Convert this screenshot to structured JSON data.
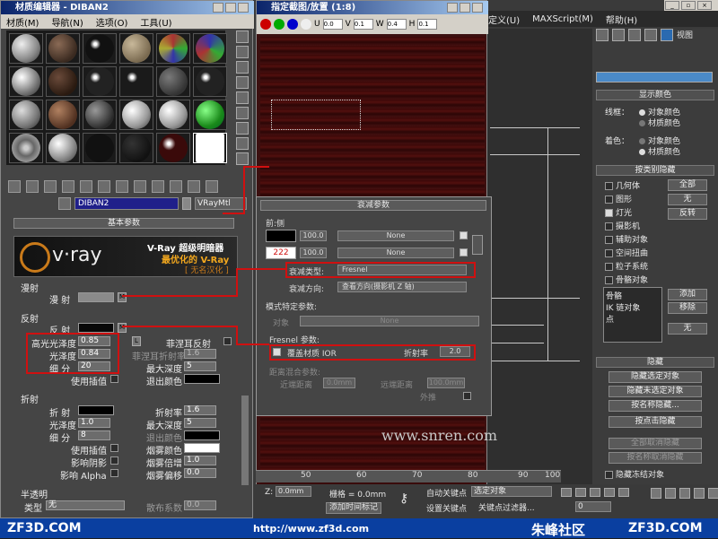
{
  "main_menu": [
    "定义(U)",
    "MAXScript(M)",
    "帮助(H)"
  ],
  "command_panel": {
    "viewport_label": "视图",
    "display_color_roll": "显示颜色",
    "wireframe_label": "线框：",
    "shaded_label": "着色：",
    "object_color": "对象颜色",
    "material_color": "材质颜色",
    "hide_by_category_roll": "按类别隐藏",
    "categories": [
      "几何体",
      "图形",
      "灯光",
      "摄影机",
      "辅助对象",
      "空间扭曲",
      "粒子系统",
      "骨骼对象"
    ],
    "all_btn": "全部",
    "none_btn": "无",
    "invert_btn": "反转",
    "list_items": [
      "骨骼",
      "IK 链对象",
      "点"
    ],
    "add_btn": "添加",
    "remove_btn": "移除",
    "none_btn2": "无",
    "hide_roll": "隐藏",
    "hide_selected": "隐藏选定对象",
    "hide_unselected": "隐藏未选定对象",
    "hide_by_name": "按名称隐藏...",
    "hide_by_hit": "按点击隐藏",
    "unhide_all": "全部取消隐藏",
    "unhide_by_name": "按名称取消隐藏",
    "hide_frozen": "隐藏冻结对象"
  },
  "material_editor": {
    "title": "材质编辑器 - DIBAN2",
    "menu": [
      "材质(M)",
      "导航(N)",
      "选项(O)",
      "工具(U)"
    ],
    "material_name": "DIBAN2",
    "material_type": "VRayMtl",
    "basic_params_roll": "基本参数",
    "vray_text1": "V-Ray 超级明暗器",
    "vray_text2": "最优化的 V-Ray",
    "vray_text3": "[ 无名汉化 ]",
    "vray_logo": "v·ray",
    "diffuse_group": "漫射",
    "diffuse_label": "漫 射",
    "reflection_group": "反射",
    "reflect_label": "反 射",
    "hilight_gloss_label": "高光光泽度",
    "hilight_gloss_value": "0.85",
    "refl_gloss_label": "光泽度",
    "refl_gloss_value": "0.84",
    "subdivs_label": "细 分",
    "subdivs_value": "20",
    "use_interp_label": "使用插值",
    "fresnel_label": "菲涅耳反射",
    "fresnel_ior_label": "菲涅耳折射率",
    "fresnel_ior_value": "1.6",
    "max_depth_label": "最大深度",
    "max_depth_value": "5",
    "exit_color_label": "退出颜色",
    "refraction_group": "折射",
    "refract_label": "折 射",
    "refr_ior_label": "折射率",
    "refr_ior_value": "1.6",
    "refr_gloss_label": "光泽度",
    "refr_gloss_value": "1.0",
    "refr_max_depth_label": "最大深度",
    "refr_max_depth_value": "5",
    "refr_subdivs_label": "细 分",
    "refr_subdivs_value": "8",
    "refr_exit_color_label": "退出颜色",
    "refr_use_interp_label": "使用插值",
    "fog_color_label": "烟雾颜色",
    "affect_shadows_label": "影响阴影",
    "fog_mult_label": "烟雾倍增",
    "fog_mult_value": "1.0",
    "affect_alpha_label": "影响 Alpha",
    "fog_bias_label": "烟雾偏移",
    "fog_bias_value": "0.0",
    "translucency_group": "半透明",
    "type_label": "类型",
    "type_value": "无",
    "scatter_label": "散布系数",
    "scatter_value": "0.0",
    "L_label": "L",
    "M_label": "M"
  },
  "zoom_window": {
    "title": "指定截图/放置 (1:8)",
    "u_label": "U",
    "u_value": "0.0",
    "v_label": "V",
    "v_value": "0.1",
    "w_label": "W",
    "w_value": "0.4",
    "h_label": "H",
    "h_value": "0.1"
  },
  "falloff": {
    "title": "衰减参数",
    "front_side": "前:侧",
    "val1": "100.0",
    "val2": "100.0",
    "none1": "None",
    "none2": "None",
    "num_222": "222",
    "falloff_type_label": "衰减类型:",
    "falloff_type_value": "Fresnel",
    "falloff_dir_label": "衰减方向:",
    "falloff_dir_value": "查看方向(摄影机 Z 轴)",
    "mode_specific": "模式特定参数:",
    "object_label": "对象",
    "none3": "None",
    "fresnel_params": "Fresnel 参数:",
    "override_ior_label": "覆盖材质 IOR",
    "ior_label": "折射率",
    "ior_value": "2.0",
    "distance_blend": "距离混合参数:",
    "near_label": "近端距离",
    "near_value": "0.0mm",
    "far_label": "远端距离",
    "far_value": "100.0mm",
    "extrap_label": "外推"
  },
  "bottom": {
    "z_label": "Z:",
    "z_value": "0.0mm",
    "grid_label": "栅格 = 0.0mm",
    "add_time_tag": "添加时间标记",
    "auto_key": "自动关键点",
    "set_key": "设置关键点",
    "selected_obj": "选定对象",
    "key_filters": "关键点过滤器...",
    "frame_value": "0",
    "ruler_ticks": [
      "50",
      "60",
      "70",
      "80",
      "90",
      "100"
    ]
  },
  "watermark": "www.snren.com",
  "brand": {
    "left": "ZF3D.COM",
    "url": "http://www.zf3d.com",
    "cn": "朱峰社区",
    "right": "ZF3D.COM"
  },
  "colors": {
    "accent_red": "#d01010",
    "brand_blue": "#0a3fa0"
  }
}
